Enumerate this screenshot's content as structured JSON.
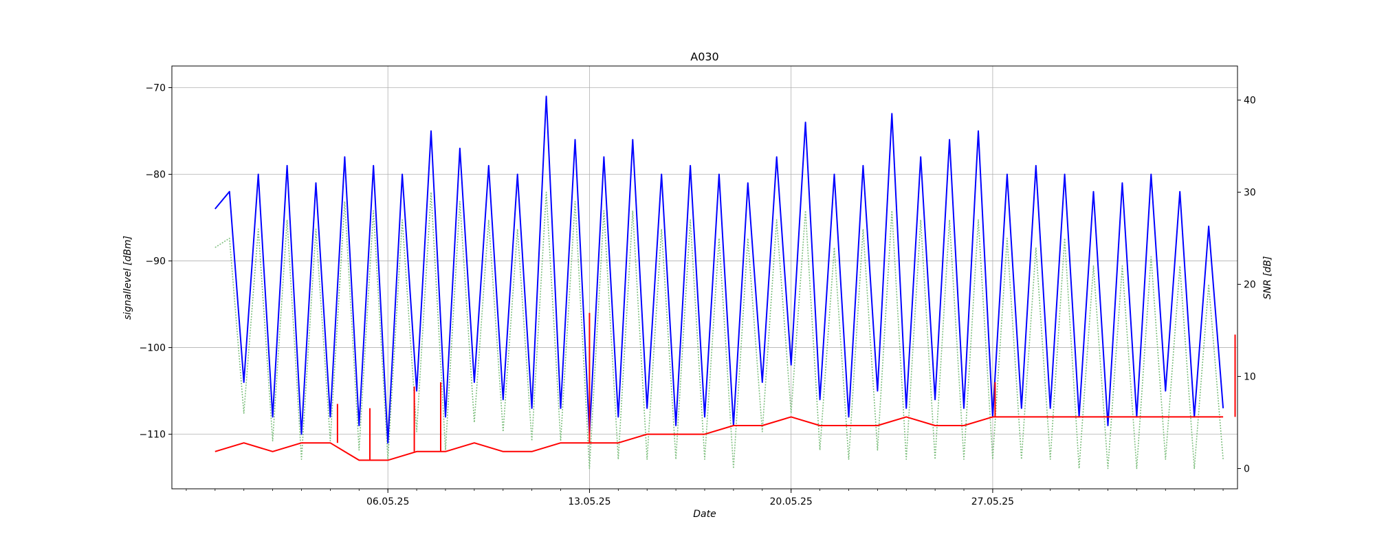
{
  "chart_data": {
    "type": "line",
    "title": "A030",
    "xlabel": "Date",
    "ylabel_left": "signallevel [dBm]",
    "ylabel_right": "SNR [dB]",
    "x_range": [
      "2025-04-28T12:00",
      "2025-06-04T12:00"
    ],
    "x_ticks": [
      {
        "date": "2025-05-06",
        "label": "06.05.25"
      },
      {
        "date": "2025-05-13",
        "label": "13.05.25"
      },
      {
        "date": "2025-05-20",
        "label": "20.05.25"
      },
      {
        "date": "2025-05-27",
        "label": "27.05.25"
      }
    ],
    "ylim_left": [
      -116.3,
      -67.5
    ],
    "yticks_left": [
      -70,
      -80,
      -90,
      -100,
      -110
    ],
    "ylim_right": [
      -2.2,
      43.7
    ],
    "yticks_right": [
      0,
      10,
      20,
      30,
      40
    ],
    "grid": true,
    "series": [
      {
        "axis": "left",
        "style": "solid",
        "color": "#0000ff",
        "points": [
          [
            "2025-04-30T00:00",
            -84
          ],
          [
            "2025-04-30T12:00",
            -82
          ],
          [
            "2025-05-01T00:00",
            -104
          ],
          [
            "2025-05-01T12:00",
            -80
          ],
          [
            "2025-05-02T00:00",
            -108
          ],
          [
            "2025-05-02T12:00",
            -79
          ],
          [
            "2025-05-03T00:00",
            -110
          ],
          [
            "2025-05-03T12:00",
            -81
          ],
          [
            "2025-05-04T00:00",
            -108
          ],
          [
            "2025-05-04T12:00",
            -78
          ],
          [
            "2025-05-05T00:00",
            -109
          ],
          [
            "2025-05-05T12:00",
            -79
          ],
          [
            "2025-05-06T00:00",
            -111
          ],
          [
            "2025-05-06T12:00",
            -80
          ],
          [
            "2025-05-07T00:00",
            -105
          ],
          [
            "2025-05-07T12:00",
            -75
          ],
          [
            "2025-05-08T00:00",
            -108
          ],
          [
            "2025-05-08T12:00",
            -77
          ],
          [
            "2025-05-09T00:00",
            -104
          ],
          [
            "2025-05-09T12:00",
            -79
          ],
          [
            "2025-05-10T00:00",
            -106
          ],
          [
            "2025-05-10T12:00",
            -80
          ],
          [
            "2025-05-11T00:00",
            -107
          ],
          [
            "2025-05-11T12:00",
            -71
          ],
          [
            "2025-05-12T00:00",
            -107
          ],
          [
            "2025-05-12T12:00",
            -76
          ],
          [
            "2025-05-13T00:00",
            -110
          ],
          [
            "2025-05-13T12:00",
            -78
          ],
          [
            "2025-05-14T00:00",
            -108
          ],
          [
            "2025-05-14T12:00",
            -76
          ],
          [
            "2025-05-15T00:00",
            -107
          ],
          [
            "2025-05-15T12:00",
            -80
          ],
          [
            "2025-05-16T00:00",
            -109
          ],
          [
            "2025-05-16T12:00",
            -79
          ],
          [
            "2025-05-17T00:00",
            -108
          ],
          [
            "2025-05-17T12:00",
            -80
          ],
          [
            "2025-05-18T00:00",
            -109
          ],
          [
            "2025-05-18T12:00",
            -81
          ],
          [
            "2025-05-19T00:00",
            -104
          ],
          [
            "2025-05-19T12:00",
            -78
          ],
          [
            "2025-05-20T00:00",
            -102
          ],
          [
            "2025-05-20T12:00",
            -74
          ],
          [
            "2025-05-21T00:00",
            -106
          ],
          [
            "2025-05-21T12:00",
            -80
          ],
          [
            "2025-05-22T00:00",
            -108
          ],
          [
            "2025-05-22T12:00",
            -79
          ],
          [
            "2025-05-23T00:00",
            -105
          ],
          [
            "2025-05-23T12:00",
            -73
          ],
          [
            "2025-05-24T00:00",
            -107
          ],
          [
            "2025-05-24T12:00",
            -78
          ],
          [
            "2025-05-25T00:00",
            -106
          ],
          [
            "2025-05-25T12:00",
            -76
          ],
          [
            "2025-05-26T00:00",
            -107
          ],
          [
            "2025-05-26T12:00",
            -75
          ],
          [
            "2025-05-27T00:00",
            -108
          ],
          [
            "2025-05-27T12:00",
            -80
          ],
          [
            "2025-05-28T00:00",
            -107
          ],
          [
            "2025-05-28T12:00",
            -79
          ],
          [
            "2025-05-29T00:00",
            -107
          ],
          [
            "2025-05-29T12:00",
            -80
          ],
          [
            "2025-05-30T00:00",
            -108
          ],
          [
            "2025-05-30T12:00",
            -82
          ],
          [
            "2025-05-31T00:00",
            -109
          ],
          [
            "2025-05-31T12:00",
            -81
          ],
          [
            "2025-06-01T00:00",
            -108
          ],
          [
            "2025-06-01T12:00",
            -80
          ],
          [
            "2025-06-02T00:00",
            -105
          ],
          [
            "2025-06-02T12:00",
            -82
          ],
          [
            "2025-06-03T00:00",
            -108
          ],
          [
            "2025-06-03T12:00",
            -86
          ],
          [
            "2025-06-04T00:00",
            -107
          ]
        ]
      },
      {
        "axis": "right",
        "style": "dotted",
        "color": "#7fbf7f",
        "points": [
          [
            "2025-04-30T00:00",
            24
          ],
          [
            "2025-04-30T12:00",
            25
          ],
          [
            "2025-05-01T00:00",
            6
          ],
          [
            "2025-05-01T12:00",
            26
          ],
          [
            "2025-05-02T00:00",
            3
          ],
          [
            "2025-05-02T12:00",
            27
          ],
          [
            "2025-05-03T00:00",
            1
          ],
          [
            "2025-05-03T12:00",
            26
          ],
          [
            "2025-05-04T00:00",
            3
          ],
          [
            "2025-05-04T12:00",
            29
          ],
          [
            "2025-05-05T00:00",
            2
          ],
          [
            "2025-05-05T12:00",
            28
          ],
          [
            "2025-05-06T00:00",
            1
          ],
          [
            "2025-05-06T12:00",
            27
          ],
          [
            "2025-05-07T00:00",
            4
          ],
          [
            "2025-05-07T12:00",
            30
          ],
          [
            "2025-05-08T00:00",
            2
          ],
          [
            "2025-05-08T12:00",
            29
          ],
          [
            "2025-05-09T00:00",
            5
          ],
          [
            "2025-05-09T12:00",
            27
          ],
          [
            "2025-05-10T00:00",
            4
          ],
          [
            "2025-05-10T12:00",
            26
          ],
          [
            "2025-05-11T00:00",
            3
          ],
          [
            "2025-05-11T12:00",
            30
          ],
          [
            "2025-05-12T00:00",
            3
          ],
          [
            "2025-05-12T12:00",
            29
          ],
          [
            "2025-05-13T00:00",
            0
          ],
          [
            "2025-05-13T12:00",
            28
          ],
          [
            "2025-05-14T00:00",
            1
          ],
          [
            "2025-05-14T12:00",
            28
          ],
          [
            "2025-05-15T00:00",
            1
          ],
          [
            "2025-05-15T12:00",
            26
          ],
          [
            "2025-05-16T00:00",
            1
          ],
          [
            "2025-05-16T12:00",
            27
          ],
          [
            "2025-05-17T00:00",
            1
          ],
          [
            "2025-05-17T12:00",
            25
          ],
          [
            "2025-05-18T00:00",
            0
          ],
          [
            "2025-05-18T12:00",
            25
          ],
          [
            "2025-05-19T00:00",
            4
          ],
          [
            "2025-05-19T12:00",
            27
          ],
          [
            "2025-05-20T00:00",
            6
          ],
          [
            "2025-05-20T12:00",
            28
          ],
          [
            "2025-05-21T00:00",
            2
          ],
          [
            "2025-05-21T12:00",
            24
          ],
          [
            "2025-05-22T00:00",
            1
          ],
          [
            "2025-05-22T12:00",
            26
          ],
          [
            "2025-05-23T00:00",
            2
          ],
          [
            "2025-05-23T12:00",
            28
          ],
          [
            "2025-05-24T00:00",
            1
          ],
          [
            "2025-05-24T12:00",
            27
          ],
          [
            "2025-05-25T00:00",
            1
          ],
          [
            "2025-05-25T12:00",
            27
          ],
          [
            "2025-05-26T00:00",
            1
          ],
          [
            "2025-05-26T12:00",
            27
          ],
          [
            "2025-05-27T00:00",
            1
          ],
          [
            "2025-05-27T12:00",
            25
          ],
          [
            "2025-05-28T00:00",
            1
          ],
          [
            "2025-05-28T12:00",
            24
          ],
          [
            "2025-05-29T00:00",
            1
          ],
          [
            "2025-05-29T12:00",
            25
          ],
          [
            "2025-05-30T00:00",
            0
          ],
          [
            "2025-05-30T12:00",
            22
          ],
          [
            "2025-05-31T00:00",
            0
          ],
          [
            "2025-05-31T12:00",
            22
          ],
          [
            "2025-06-01T00:00",
            0
          ],
          [
            "2025-06-01T12:00",
            23
          ],
          [
            "2025-06-02T00:00",
            1
          ],
          [
            "2025-06-02T12:00",
            22
          ],
          [
            "2025-06-03T00:00",
            0
          ],
          [
            "2025-06-03T12:00",
            20
          ],
          [
            "2025-06-04T00:00",
            1
          ]
        ]
      },
      {
        "axis": "left",
        "style": "solid",
        "color": "#ff0000",
        "points": [
          [
            "2025-04-30T00:00",
            -112
          ],
          [
            "2025-05-01T00:00",
            -111
          ],
          [
            "2025-05-02T00:00",
            -112
          ],
          [
            "2025-05-03T00:00",
            -111
          ],
          [
            "2025-05-04T00:00",
            -111
          ],
          [
            "2025-05-05T00:00",
            -113
          ],
          [
            "2025-05-06T00:00",
            -113
          ],
          [
            "2025-05-07T00:00",
            -112
          ],
          [
            "2025-05-08T00:00",
            -112
          ],
          [
            "2025-05-09T00:00",
            -111
          ],
          [
            "2025-05-10T00:00",
            -112
          ],
          [
            "2025-05-11T00:00",
            -112
          ],
          [
            "2025-05-12T00:00",
            -111
          ],
          [
            "2025-05-13T00:00",
            -111
          ],
          [
            "2025-05-14T00:00",
            -111
          ],
          [
            "2025-05-15T00:00",
            -110
          ],
          [
            "2025-05-16T00:00",
            -110
          ],
          [
            "2025-05-17T00:00",
            -110
          ],
          [
            "2025-05-18T00:00",
            -109
          ],
          [
            "2025-05-19T00:00",
            -109
          ],
          [
            "2025-05-20T00:00",
            -108
          ],
          [
            "2025-05-21T00:00",
            -109
          ],
          [
            "2025-05-22T00:00",
            -109
          ],
          [
            "2025-05-23T00:00",
            -109
          ],
          [
            "2025-05-24T00:00",
            -108
          ],
          [
            "2025-05-25T00:00",
            -109
          ],
          [
            "2025-05-26T00:00",
            -109
          ],
          [
            "2025-05-27T00:00",
            -108
          ],
          [
            "2025-05-28T00:00",
            -108
          ],
          [
            "2025-05-29T00:00",
            -108
          ],
          [
            "2025-05-30T00:00",
            -108
          ],
          [
            "2025-05-31T00:00",
            -108
          ],
          [
            "2025-06-01T00:00",
            -108
          ],
          [
            "2025-06-02T00:00",
            -108
          ],
          [
            "2025-06-03T00:00",
            -108
          ],
          [
            "2025-06-04T00:00",
            -108
          ]
        ],
        "spikes": [
          [
            "2025-05-04T06:00",
            -106.5
          ],
          [
            "2025-05-05T09:00",
            -107
          ],
          [
            "2025-05-06T22:00",
            -104.5
          ],
          [
            "2025-05-07T20:00",
            -104
          ],
          [
            "2025-05-13T00:00",
            -96
          ],
          [
            "2025-05-27T02:00",
            -104
          ],
          [
            "2025-06-04T10:00",
            -98.5
          ]
        ]
      }
    ]
  }
}
